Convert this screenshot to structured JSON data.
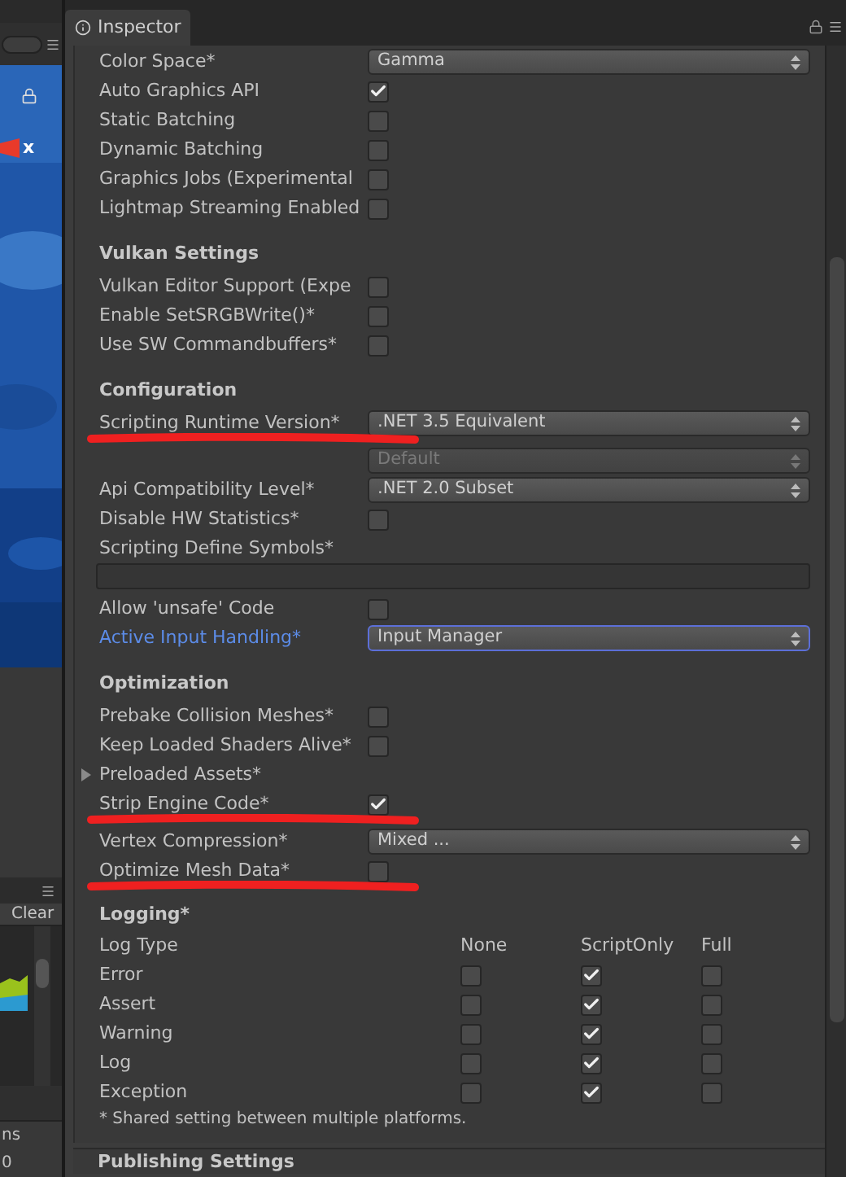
{
  "left_panel": {
    "scene_axis": "x",
    "console_button": "Clear",
    "label": "ns",
    "value": "0"
  },
  "inspector": {
    "tab": "Inspector",
    "sections": [
      {
        "rows": [
          {
            "kind": "dropdown",
            "label": "Color Space*",
            "value": "Gamma",
            "disabled": false,
            "focused": false,
            "underlined": false
          },
          {
            "kind": "checkbox",
            "label": "Auto Graphics API",
            "checked": true,
            "underlined": false
          },
          {
            "kind": "checkbox",
            "label": "Static Batching",
            "checked": false,
            "underlined": false
          },
          {
            "kind": "checkbox",
            "label": "Dynamic Batching",
            "checked": false,
            "underlined": false
          },
          {
            "kind": "checkbox",
            "label": "Graphics Jobs (Experimental",
            "checked": false,
            "underlined": false
          },
          {
            "kind": "checkbox",
            "label": "Lightmap Streaming Enabled",
            "checked": false,
            "underlined": false
          }
        ]
      },
      {
        "title": "Vulkan Settings",
        "rows": [
          {
            "kind": "checkbox",
            "label": "Vulkan Editor Support (Expe",
            "checked": false,
            "underlined": false
          },
          {
            "kind": "checkbox",
            "label": "Enable SetSRGBWrite()*",
            "checked": false,
            "underlined": false
          },
          {
            "kind": "checkbox",
            "label": "Use SW Commandbuffers*",
            "checked": false,
            "underlined": false
          }
        ]
      },
      {
        "title": "Configuration",
        "rows": [
          {
            "kind": "dropdown",
            "label": "Scripting Runtime Version*",
            "value": ".NET 3.5 Equivalent",
            "disabled": false,
            "focused": false,
            "underlined": true
          },
          {
            "kind": "dropdown",
            "value": "Default",
            "disabled": true,
            "focused": false,
            "underlined": false
          },
          {
            "kind": "dropdown",
            "label": "Api Compatibility Level*",
            "value": ".NET 2.0 Subset",
            "disabled": false,
            "focused": false,
            "underlined": false
          },
          {
            "kind": "checkbox",
            "label": "Disable HW Statistics*",
            "checked": false,
            "underlined": false
          },
          {
            "kind": "label",
            "label": "Scripting Define Symbols*",
            "underlined": false
          },
          {
            "kind": "textfield",
            "underlined": false
          },
          {
            "kind": "checkbox",
            "label": "Allow 'unsafe' Code",
            "checked": false,
            "underlined": false
          },
          {
            "kind": "dropdown",
            "label": "Active Input Handling*",
            "value": "Input Manager",
            "disabled": false,
            "focused": true,
            "underlined": false
          }
        ]
      },
      {
        "title": "Optimization",
        "rows": [
          {
            "kind": "checkbox",
            "label": "Prebake Collision Meshes*",
            "checked": false,
            "underlined": false
          },
          {
            "kind": "checkbox",
            "label": "Keep Loaded Shaders Alive*",
            "checked": false,
            "underlined": false
          },
          {
            "kind": "foldout",
            "label": "Preloaded Assets*",
            "expanded": false,
            "underlined": false
          },
          {
            "kind": "checkbox",
            "label": "Strip Engine Code*",
            "checked": true,
            "underlined": true
          },
          {
            "kind": "dropdown",
            "label": "Vertex Compression*",
            "value": "Mixed ...",
            "disabled": false,
            "focused": false,
            "underlined": false
          },
          {
            "kind": "checkbox",
            "label": "Optimize Mesh Data*",
            "checked": false,
            "underlined": true
          }
        ]
      }
    ],
    "logging": {
      "title": "Logging*",
      "columns": [
        "Log Type",
        "None",
        "ScriptOnly",
        "Full"
      ],
      "rows": [
        {
          "label": "Error",
          "checks": [
            false,
            true,
            false
          ]
        },
        {
          "label": "Assert",
          "checks": [
            false,
            true,
            false
          ]
        },
        {
          "label": "Warning",
          "checks": [
            false,
            true,
            false
          ]
        },
        {
          "label": "Log",
          "checks": [
            false,
            true,
            false
          ]
        },
        {
          "label": "Exception",
          "checks": [
            false,
            true,
            false
          ]
        }
      ]
    },
    "footnote": "* Shared setting between multiple platforms.",
    "next_section": "Publishing Settings"
  }
}
